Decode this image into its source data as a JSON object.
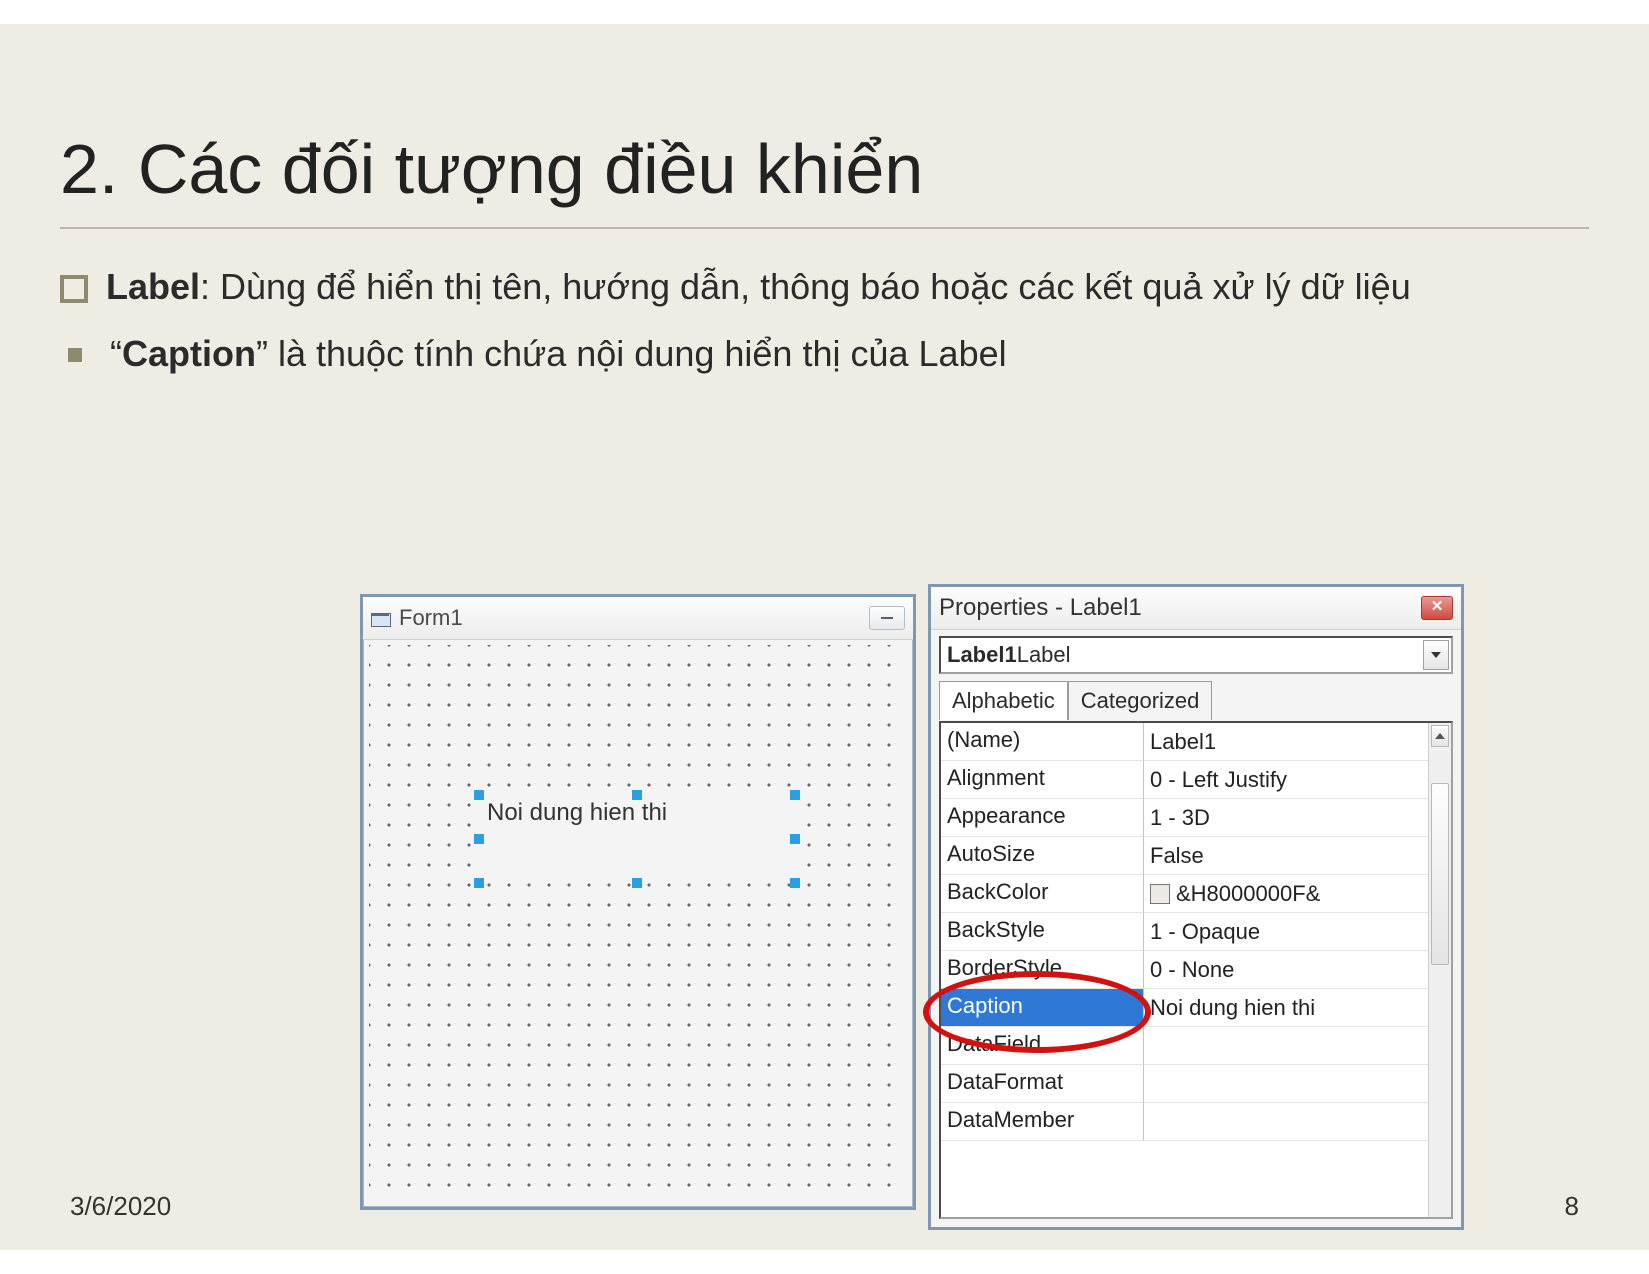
{
  "title": "2. Các đối tượng điều khiển",
  "bullets": {
    "b1_bold": "Label",
    "b1_rest": ": Dùng để hiển thị tên, hướng dẫn, thông báo hoặc các kết quả xử lý dữ liệu",
    "b2_prequote": "“",
    "b2_bold": "Caption",
    "b2_rest": "” là thuộc tính chứa nội dung hiển thị của Label"
  },
  "form": {
    "title": "Form1",
    "label_content": "Noi dung hien thi"
  },
  "properties": {
    "title": "Properties - Label1",
    "combo_bold": "Label1",
    "combo_type": " Label",
    "tabs": {
      "alpha": "Alphabetic",
      "cat": "Categorized"
    },
    "rows": [
      {
        "name": "(Name)",
        "value": "Label1"
      },
      {
        "name": "Alignment",
        "value": "0 - Left Justify"
      },
      {
        "name": "Appearance",
        "value": "1 - 3D"
      },
      {
        "name": "AutoSize",
        "value": "False"
      },
      {
        "name": "BackColor",
        "value": "&H8000000F&",
        "swatch": true
      },
      {
        "name": "BackStyle",
        "value": "1 - Opaque"
      },
      {
        "name": "BorderStyle",
        "value": "0 - None"
      },
      {
        "name": "Caption",
        "value": "Noi dung hien thi",
        "selected": true
      },
      {
        "name": "DataField",
        "value": ""
      },
      {
        "name": "DataFormat",
        "value": ""
      },
      {
        "name": "DataMember",
        "value": ""
      }
    ]
  },
  "footer": {
    "date": "3/6/2020",
    "page": "8"
  }
}
